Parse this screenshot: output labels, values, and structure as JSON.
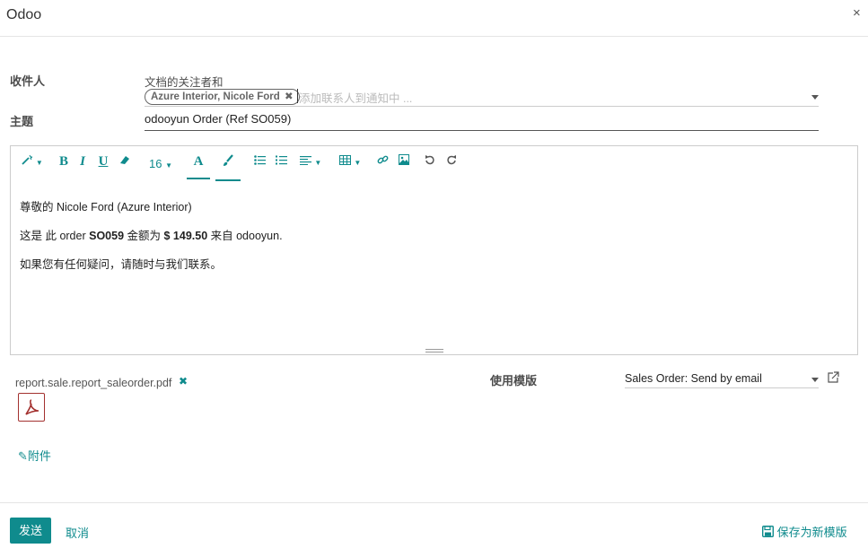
{
  "dialog": {
    "title": "Odoo",
    "close_icon": "×"
  },
  "recipients": {
    "label": "收件人",
    "followers_text": "文档的关注者和",
    "tag": "Azure Interior, Nicole Ford",
    "placeholder": "添加联系人到通知中 ..."
  },
  "subject": {
    "label": "主题",
    "value": "odooyun Order (Ref SO059)"
  },
  "toolbar": {
    "font_size": "16"
  },
  "body": {
    "greeting": "尊敬的 Nicole Ford (Azure Interior)",
    "line2_pre": "这是 此 order ",
    "line2_order": "SO059",
    "line2_mid": " 金额为 ",
    "line2_amount": "$ 149.50",
    "line2_post": " 来自 odooyun.",
    "line3": "如果您有任何疑问，请随时与我们联系。"
  },
  "attachment": {
    "filename": "report.sale.report_saleorder.pdf",
    "add_label": "附件"
  },
  "template": {
    "label": "使用模版",
    "value": "Sales Order: Send by email"
  },
  "footer": {
    "send_label": "发送",
    "cancel_label": "取消",
    "save_template_label": "保存为新模版"
  },
  "colors": {
    "accent": "#0f8b8d",
    "pdf": "#a3312f"
  }
}
